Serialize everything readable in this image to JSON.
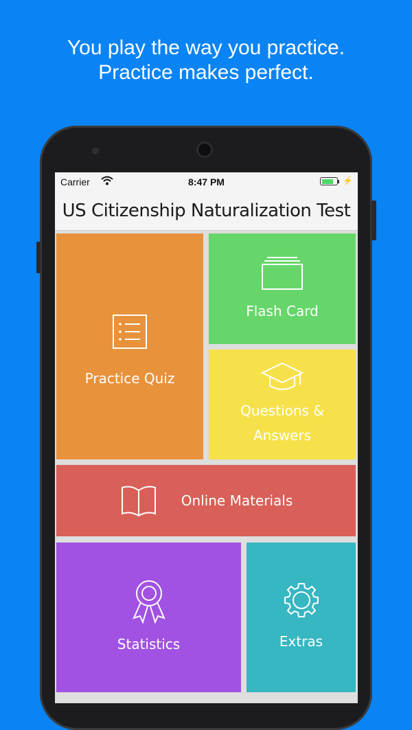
{
  "promo": {
    "line1": "You play the way you practice.",
    "line2": "Practice makes perfect."
  },
  "statusbar": {
    "carrier": "Carrier",
    "time": "8:47 PM",
    "battery_level": 0.8,
    "battery_charging": true
  },
  "app": {
    "title": "US Citizenship Naturalization Test"
  },
  "tiles": {
    "practice_quiz": {
      "label": "Practice Quiz",
      "icon": "list-icon",
      "color": "#e8923c"
    },
    "flash_card": {
      "label": "Flash Card",
      "icon": "cards-icon",
      "color": "#66d66b"
    },
    "questions_answers": {
      "label": "Questions &\nAnswers",
      "icon": "graduation-cap-icon",
      "color": "#f6e14a"
    },
    "online_materials": {
      "label": "Online Materials",
      "icon": "book-icon",
      "color": "#d86058"
    },
    "statistics": {
      "label": "Statistics",
      "icon": "award-ribbon-icon",
      "color": "#a152e2"
    },
    "extras": {
      "label": "Extras",
      "icon": "gear-icon",
      "color": "#36b7c2"
    }
  },
  "colors": {
    "background": "#0a84f5",
    "phone_body": "#1c1c1e"
  }
}
